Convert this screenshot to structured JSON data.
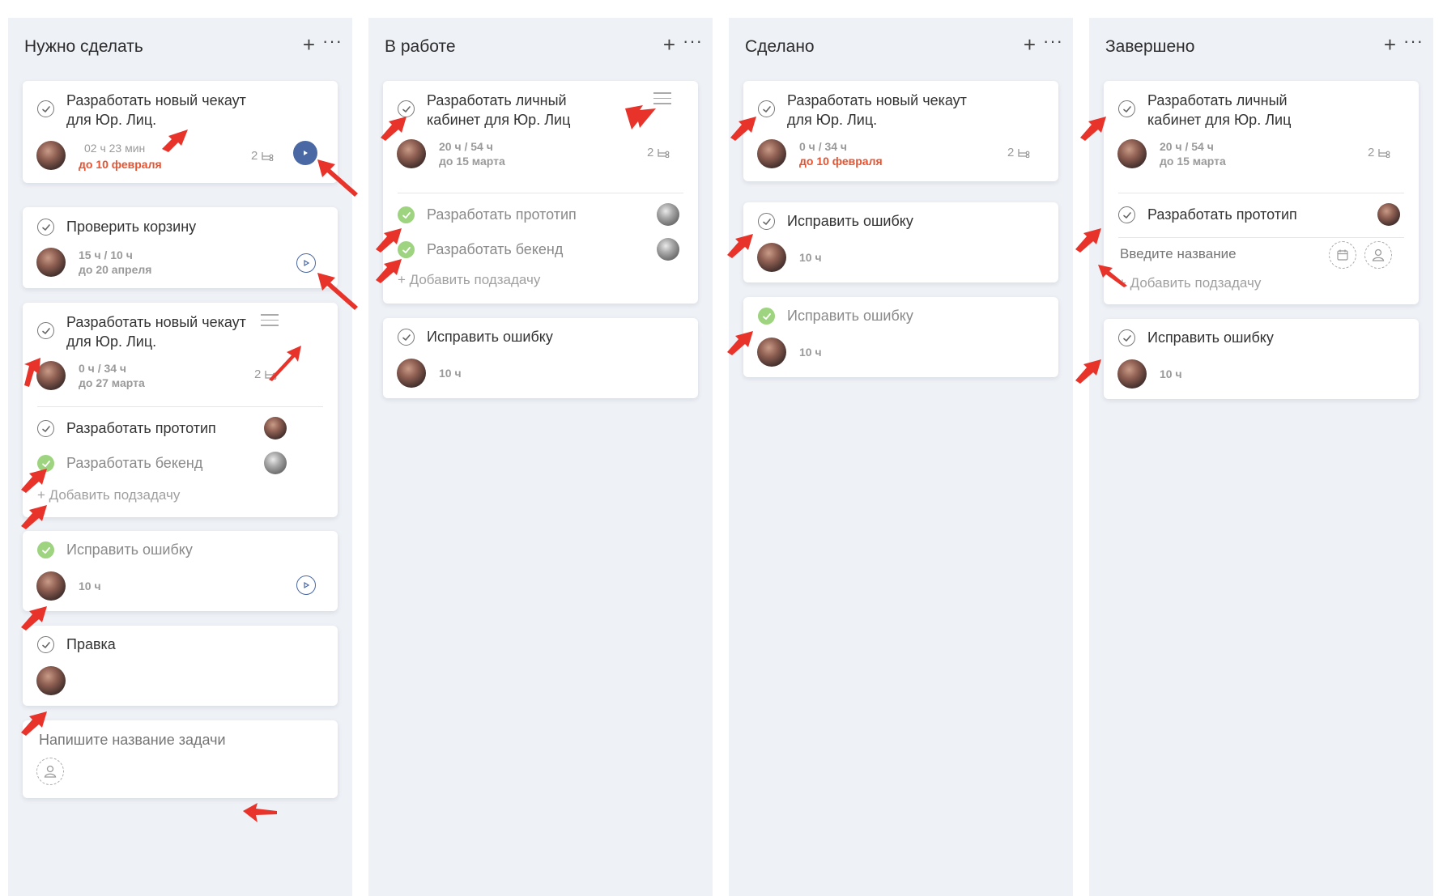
{
  "columns": [
    {
      "title": "Нужно сделать",
      "add": "+",
      "more": "···"
    },
    {
      "title": "В работе",
      "add": "+",
      "more": "···"
    },
    {
      "title": "Сделано",
      "add": "+",
      "more": "···"
    },
    {
      "title": "Завершено",
      "add": "+",
      "more": "···"
    }
  ],
  "col1": {
    "c1": {
      "title1": "Разработать новый чекаут",
      "title2": "для Юр. Лиц.",
      "time": "02 ч 23 мин",
      "due": "до 10 февраля",
      "subs": "2"
    },
    "c2": {
      "title": "Проверить корзину",
      "time": "15 ч / 10 ч",
      "due": "до 20 апреля"
    },
    "c3": {
      "title1": "Разработать новый чекаут",
      "title2": "для Юр. Лиц.",
      "time": "0 ч / 34 ч",
      "due": "до 27 марта",
      "subs": "2",
      "sub1": "Разработать прототип",
      "sub2": "Разработать бекенд",
      "add_sub": "+ Добавить подзадачу"
    },
    "c4": {
      "title": "Исправить ошибку",
      "time": "10 ч"
    },
    "c5": {
      "title": "Правка"
    },
    "c6": {
      "placeholder": "Напишите название задачи"
    }
  },
  "col2": {
    "c1": {
      "title1": "Разработать личный",
      "title2": "кабинет для Юр. Лиц",
      "time": "20 ч / 54 ч",
      "due": "до 15 марта",
      "subs": "2",
      "sub1": "Разработать прототип",
      "sub2": "Разработать бекенд",
      "add_sub": "+ Добавить подзадачу"
    },
    "c2": {
      "title": "Исправить ошибку",
      "time": "10 ч"
    }
  },
  "col3": {
    "c1": {
      "title1": "Разработать новый чекаут",
      "title2": "для Юр. Лиц.",
      "time": "0 ч / 34 ч",
      "due": "до 10 февраля",
      "subs": "2"
    },
    "c2": {
      "title": "Исправить ошибку",
      "time": "10 ч"
    },
    "c3": {
      "title": "Исправить ошибку",
      "time": "10 ч"
    }
  },
  "col4": {
    "c1": {
      "title1": "Разработать личный",
      "title2": "кабинет для Юр. Лиц",
      "time": "20 ч / 54 ч",
      "due": "до 15 марта",
      "subs": "2",
      "sub1": "Разработать прототип",
      "sub_placeholder": "Введите название",
      "add_sub": "+ Добавить подзадачу"
    },
    "c2": {
      "title": "Исправить ошибку",
      "time": "10 ч"
    }
  },
  "colors": {
    "accent": "#4a68a3",
    "due_red": "#e8522f",
    "done_green": "#9ed37f",
    "arrow_red": "#e8332a"
  }
}
